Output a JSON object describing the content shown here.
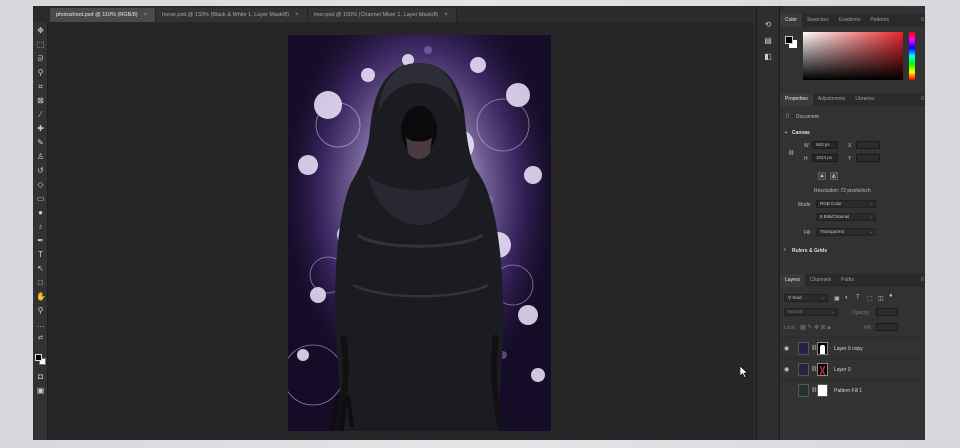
{
  "tabs": [
    {
      "label": "photoshoot.psd @ 110% (RGB/8)",
      "active": true
    },
    {
      "label": "horse.psd @ 133% (Black & White 1, Layer Mask/8)",
      "active": false
    },
    {
      "label": "river.psd @ 100% (Channel Mixer 1, Layer Mask/8)",
      "active": false
    }
  ],
  "close_glyph": "×",
  "tools": [
    "move-tool",
    "marquee-tool",
    "lasso-tool",
    "quick-select-tool",
    "crop-tool",
    "frame-tool",
    "eyedropper-tool",
    "healing-brush-tool",
    "brush-tool",
    "clone-stamp-tool",
    "history-brush-tool",
    "eraser-tool",
    "gradient-tool",
    "blur-tool",
    "dodge-tool",
    "pen-tool",
    "type-tool",
    "path-select-tool",
    "rectangle-tool",
    "hand-tool",
    "zoom-tool",
    "more-tools"
  ],
  "color_panel": {
    "tabs": [
      "Color",
      "Swatches",
      "Gradients",
      "Patterns"
    ],
    "active_tab": "Color",
    "foreground": "#000000",
    "background": "#ffffff",
    "hue_color": "#e8252b"
  },
  "properties": {
    "tabs": [
      "Properties",
      "Adjustments",
      "Libraries"
    ],
    "active_tab": "Properties",
    "document_label": "Document",
    "canvas_header": "Canvas",
    "w_label": "W",
    "w_value": "683 px",
    "h_label": "H",
    "h_value": "1024 px",
    "x_label": "X",
    "y_label": "Y",
    "resolution": "Resolution: 72 pixels/inch",
    "mode_label": "Mode",
    "mode_value": "RGB Color",
    "depth_value": "8 Bits/Channel",
    "fill_label": "Fill",
    "fill_value": "Transparent",
    "rulers_header": "Rulers & Grids"
  },
  "layers": {
    "tabs": [
      "Layers",
      "Channels",
      "Paths"
    ],
    "active_tab": "Layers",
    "filter_label": "Kind",
    "blend_mode": "Normal",
    "opacity_label": "Opacity:",
    "lock_label": "Lock:",
    "fill_label": "Fill:",
    "items": [
      {
        "name": "Layer 0 copy",
        "visible": true
      },
      {
        "name": "Layer 0",
        "visible": true
      },
      {
        "name": "Pattern Fill 1",
        "visible": false
      }
    ]
  }
}
